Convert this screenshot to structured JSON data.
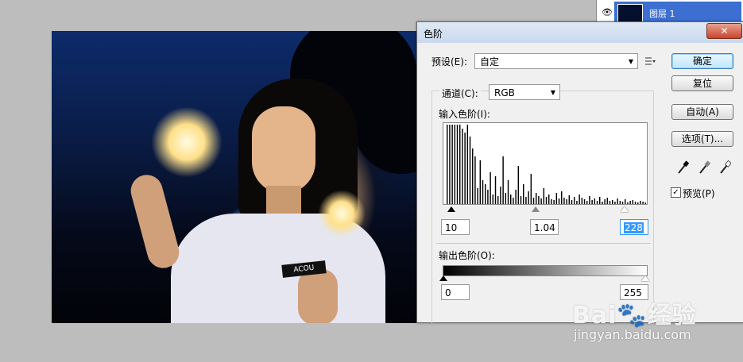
{
  "layers_panel": {
    "layer_name": "图层 1",
    "eye_icon": "eye-icon"
  },
  "photo": {
    "badge_text": "ACOU"
  },
  "dialog": {
    "title": "色阶",
    "close_label": "✕",
    "preset_label": "预设(E):",
    "preset_value": "自定",
    "channel_label": "通道(C):",
    "channel_value": "RGB",
    "input_levels_label": "输入色阶(I):",
    "input_black": "10",
    "input_gamma": "1.04",
    "input_white": "228",
    "output_levels_label": "输出色阶(O):",
    "output_black": "0",
    "output_white": "255",
    "buttons": {
      "ok": "确定",
      "reset": "复位",
      "auto": "自动(A)",
      "options": "选项(T)..."
    },
    "preview_label": "预览(P)",
    "preview_checked": true,
    "colors": {
      "accent": "#3399ff",
      "title_bg": "#c9d9ee",
      "close": "#c9452c"
    }
  },
  "chart_data": {
    "type": "bar",
    "title": "",
    "xlabel": "",
    "ylabel": "",
    "xlim": [
      0,
      255
    ],
    "ylim": [
      0,
      100
    ],
    "values": [
      100,
      100,
      100,
      100,
      100,
      100,
      95,
      90,
      100,
      85,
      70,
      60,
      20,
      55,
      30,
      25,
      18,
      40,
      12,
      35,
      10,
      22,
      60,
      14,
      30,
      12,
      8,
      18,
      48,
      10,
      25,
      9,
      16,
      38,
      8,
      14,
      10,
      7,
      20,
      9,
      12,
      6,
      5,
      14,
      7,
      16,
      8,
      6,
      11,
      5,
      9,
      4,
      12,
      8,
      6,
      4,
      10,
      5,
      7,
      4,
      9,
      3,
      6,
      8,
      4,
      5,
      3,
      7,
      4,
      3,
      6,
      2,
      4,
      5,
      3,
      2,
      4,
      3,
      2,
      3
    ]
  }
}
